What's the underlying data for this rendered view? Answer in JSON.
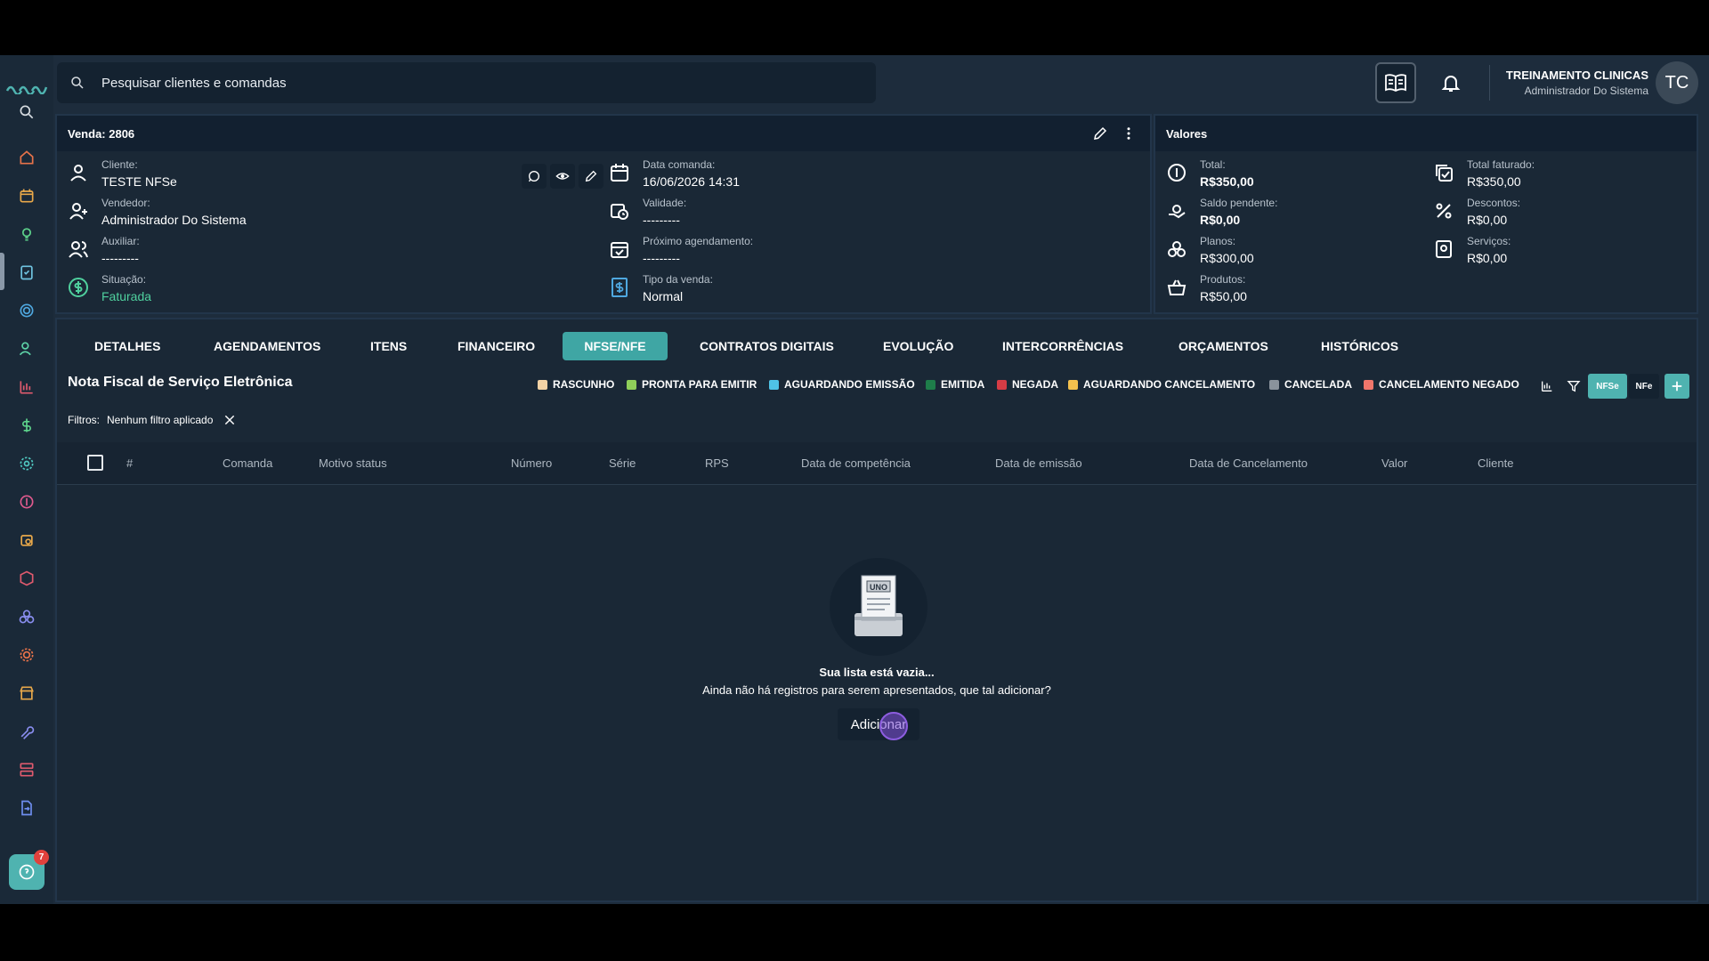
{
  "search": {
    "placeholder": "Pesquisar clientes e comandas"
  },
  "user": {
    "name": "TREINAMENTO CLINICAS",
    "role": "Administrador Do Sistema",
    "initials": "TC"
  },
  "help": {
    "badge": "7"
  },
  "sale": {
    "title": "Venda: 2806",
    "fields": {
      "cliente": {
        "label": "Cliente:",
        "value": "TESTE NFSe"
      },
      "vendedor": {
        "label": "Vendedor:",
        "value": "Administrador Do Sistema"
      },
      "auxiliar": {
        "label": "Auxiliar:",
        "value": "---------"
      },
      "situacao": {
        "label": "Situação:",
        "value": "Faturada"
      },
      "data_comanda": {
        "label": "Data comanda:",
        "value": "16/06/2026 14:31"
      },
      "validade": {
        "label": "Validade:",
        "value": "---------"
      },
      "proximo": {
        "label": "Próximo agendamento:",
        "value": "---------"
      },
      "tipo": {
        "label": "Tipo da venda:",
        "value": "Normal"
      }
    }
  },
  "values": {
    "title": "Valores",
    "total": {
      "label": "Total:",
      "value": "R$350,00"
    },
    "saldo": {
      "label": "Saldo pendente:",
      "value": "R$0,00"
    },
    "planos": {
      "label": "Planos:",
      "value": "R$300,00"
    },
    "produtos": {
      "label": "Produtos:",
      "value": "R$50,00"
    },
    "faturado": {
      "label": "Total faturado:",
      "value": "R$350,00"
    },
    "descontos": {
      "label": "Descontos:",
      "value": "R$0,00"
    },
    "servicos": {
      "label": "Serviços:",
      "value": "R$0,00"
    }
  },
  "tabs": [
    "DETALHES",
    "AGENDAMENTOS",
    "ITENS",
    "FINANCEIRO",
    "NFSE/NFE",
    "CONTRATOS DIGITAIS",
    "EVOLUÇÃO",
    "INTERCORRÊNCIAS",
    "ORÇAMENTOS",
    "HISTÓRICOS"
  ],
  "active_tab": "NFSE/NFE",
  "nfse": {
    "title": "Nota Fiscal de Serviço Eletrônica",
    "legend": [
      {
        "label": "RASCUNHO",
        "color": "#f3d3a6"
      },
      {
        "label": "PRONTA PARA EMITIR",
        "color": "#8fcf5a"
      },
      {
        "label": "AGUARDANDO EMISSÃO",
        "color": "#4fc3e6"
      },
      {
        "label": "EMITIDA",
        "color": "#1e7d4a"
      },
      {
        "label": "NEGADA",
        "color": "#d63c45"
      },
      {
        "label": "AGUARDANDO CANCELAMENTO",
        "color": "#f3c14e"
      },
      {
        "label": "CANCELADA",
        "color": "#8a939c"
      },
      {
        "label": "CANCELAMENTO NEGADO",
        "color": "#f0766b"
      }
    ],
    "toggle_nfse": "NFSe",
    "toggle_nfe": "NFe",
    "filters_label": "Filtros:",
    "filters_value": "Nenhum filtro aplicado",
    "columns": [
      "#",
      "Comanda",
      "Motivo status",
      "Número",
      "Série",
      "RPS",
      "Data de competência",
      "Data de emissão",
      "Data de Cancelamento",
      "Valor",
      "Cliente"
    ],
    "empty_illustration_text": "UNO",
    "empty_title": "Sua lista está vazia...",
    "empty_sub": "Ainda não há registros para serem apresentados, que tal adicionar?",
    "add_label": "Adicionar"
  }
}
